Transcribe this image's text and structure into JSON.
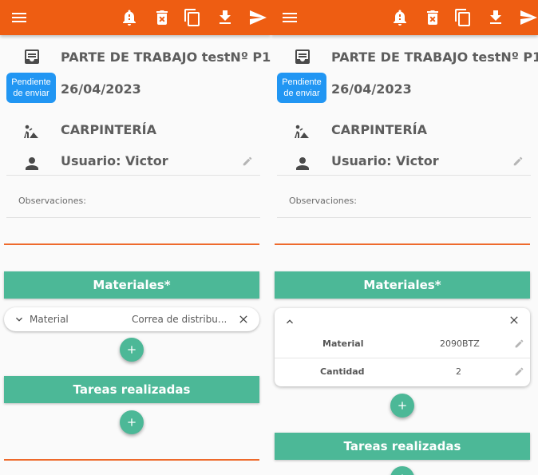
{
  "header": {
    "title": "PARTE DE TRABAJO testNº P1",
    "status_badge": "Pendiente de enviar",
    "date": "26/04/2023",
    "trade": "CARPINTERÍA",
    "user": "Usuario: Victor"
  },
  "observations": {
    "label": "Observaciones:"
  },
  "sections": {
    "materials_title": "Materiales*",
    "tasks_title": "Tareas realizadas"
  },
  "material_collapsed": {
    "label": "Material",
    "value": "Correa de distribu..."
  },
  "material_expanded": {
    "rows": [
      {
        "label": "Material",
        "value": "2090BTZ"
      },
      {
        "label": "Cantidad",
        "value": "2"
      }
    ]
  },
  "colors": {
    "appbar": "#ee5d12",
    "accent_green": "#4cb897",
    "badge_blue": "#2196f3"
  },
  "icons": {
    "toolbar": [
      "menu-icon",
      "bell-icon",
      "delete-icon",
      "copy-icon",
      "download-icon",
      "send-icon"
    ]
  }
}
